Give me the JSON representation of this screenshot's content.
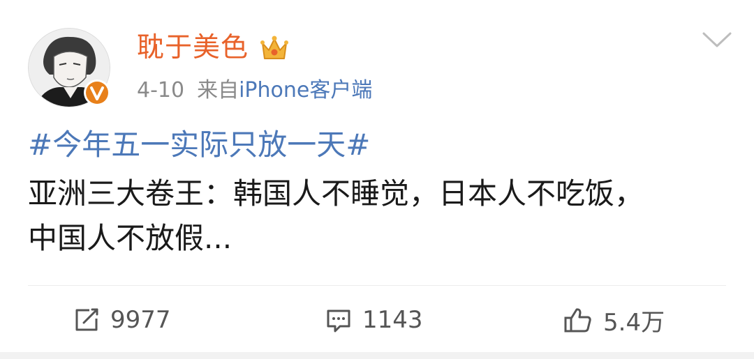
{
  "post": {
    "username": "耽于美色",
    "date": "4-10",
    "source_prefix": "来自",
    "source_name": "iPhone客户端",
    "hashtag": "#今年五一实际只放一天#",
    "text": "亚洲三大卷王：韩国人不睡觉，日本人不吃饭，中国人不放假..."
  },
  "actions": {
    "repost_count": "9977",
    "comment_count": "1143",
    "like_count": "5.4万"
  },
  "icons": {
    "avatar": "anime-avatar",
    "vip": "verified-v-icon",
    "member": "crown-icon",
    "menu": "chevron-down-icon",
    "repost": "repost-icon",
    "comment": "comment-icon",
    "like": "thumbs-up-icon"
  },
  "colors": {
    "username": "#e8622a",
    "link": "#4c78b8",
    "meta": "#8a8a8a",
    "vip_badge": "#e8801a"
  }
}
